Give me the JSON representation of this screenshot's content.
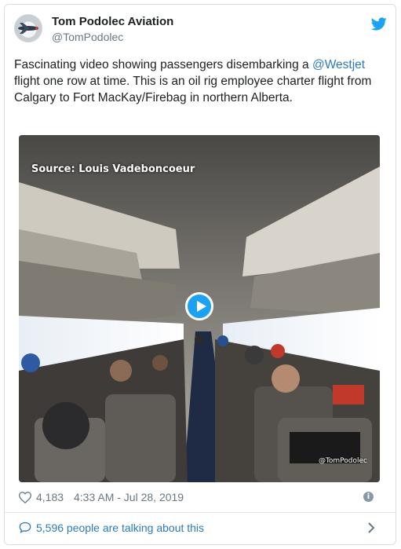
{
  "author": {
    "name": "Tom Podolec Aviation",
    "handle": "@TomPodolec"
  },
  "tweet": {
    "text_before": "Fascinating video showing passengers disembarking a ",
    "mention": "@Westjet",
    "text_after": " flight one row at time. This is an oil rig employee charter flight from Calgary to Fort MacKay/Firebag in northern Alberta."
  },
  "media": {
    "source_caption": "Source: Louis Vadeboncoeur",
    "watermark": "@TomPodolec",
    "play_icon": "play-icon"
  },
  "meta": {
    "likes": "4,183",
    "timestamp": "4:33 AM - Jul 28, 2019"
  },
  "footer": {
    "talking": "5,596 people are talking about this"
  },
  "colors": {
    "link": "#2b7bb9",
    "twitter_blue": "#1da1f2",
    "muted": "#697882"
  },
  "icons": [
    "twitter-bird-icon",
    "heart-icon",
    "info-icon",
    "speech-bubble-icon",
    "chevron-right-icon"
  ]
}
